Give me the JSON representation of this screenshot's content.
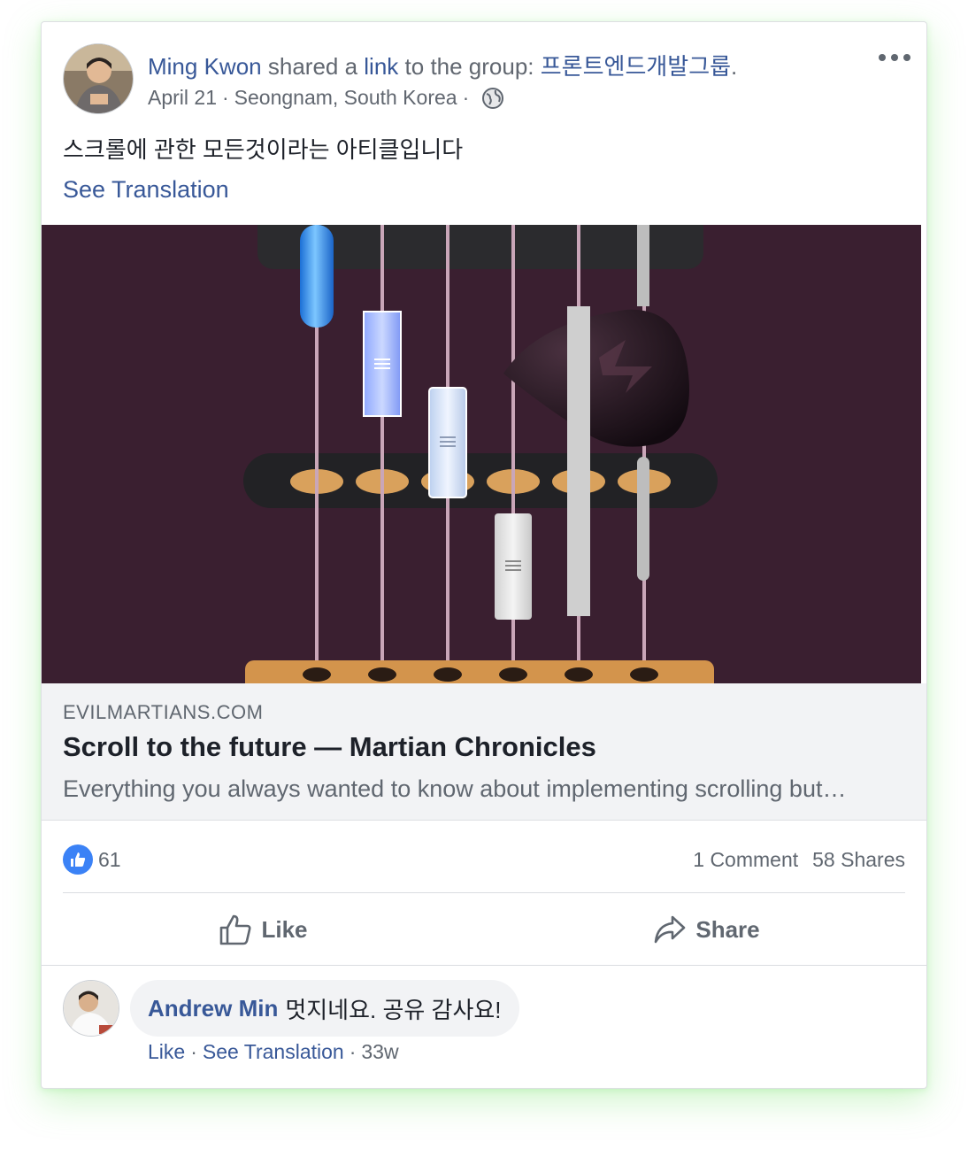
{
  "post": {
    "author": "Ming Kwon",
    "shared_text": "shared a",
    "link_word": "link",
    "to_group_text": "to the group:",
    "group_name": "프론트엔드개발그룹",
    "group_suffix": ".",
    "date": "April 21",
    "location": "Seongnam, South Korea",
    "separator": "·",
    "privacy_icon": "globe-icon",
    "body": "스크롤에 관한 모든것이라는 아티클입니다",
    "see_translation": "See Translation"
  },
  "link_preview": {
    "domain": "EVILMARTIANS.COM",
    "title": "Scroll to the future — Martian Chronicles",
    "description": "Everything you always wanted to know about implementing scrolling but…"
  },
  "stats": {
    "reaction_icon": "like-icon",
    "reaction_count": "61",
    "comments": "1 Comment",
    "shares": "58 Shares"
  },
  "actions": {
    "like": "Like",
    "share": "Share"
  },
  "comment": {
    "author": "Andrew Min",
    "text": "멋지네요. 공유 감사요!",
    "like": "Like",
    "see_translation": "See Translation",
    "separator": "·",
    "age": "33w"
  },
  "colors": {
    "link_blue": "#385898",
    "like_blue": "#3b82f6",
    "image_bg": "#3a1f30",
    "preview_bg": "#f2f3f5",
    "shadow_green": "#78e66e"
  }
}
